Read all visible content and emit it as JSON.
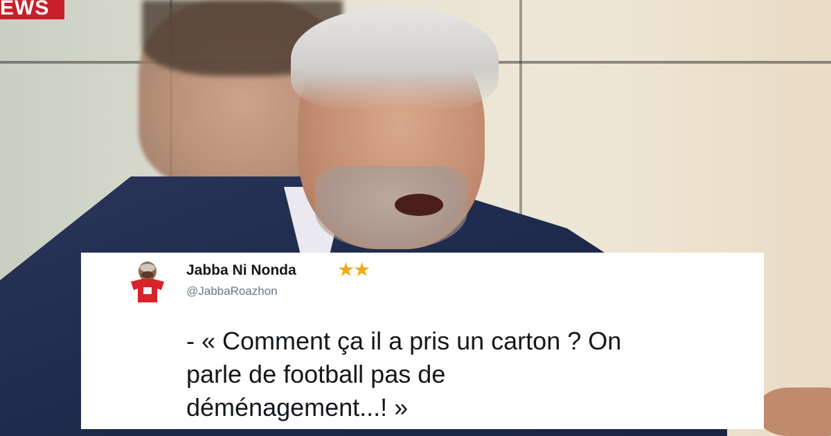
{
  "channel_logo": {
    "text": "EWS",
    "color": "#c8202b"
  },
  "tweet": {
    "display_name": "Jabba Ni Nonda",
    "badge": "★★",
    "handle": "@JabbaRoazhon",
    "text": "- « Comment ça il a pris un carton ? On\nparle de football pas de\ndéménagement...! »",
    "avatar_icon": "puppet-avatar",
    "star_color": "#f0a81a"
  }
}
